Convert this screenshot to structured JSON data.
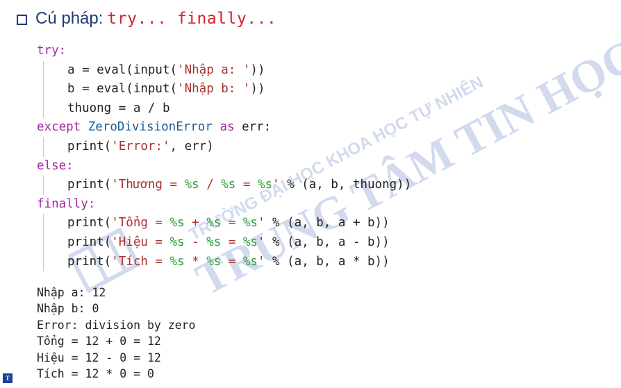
{
  "heading": {
    "label": "Cú pháp:",
    "code": "try... finally..."
  },
  "code": {
    "l1": "try:",
    "l2_pre": "a = eval(input(",
    "l2_str": "'Nhập a: '",
    "l2_post": "))",
    "l3_pre": "b = eval(input(",
    "l3_str": "'Nhập b: '",
    "l3_post": "))",
    "l4": "thuong = a / b",
    "l5_kw": "except",
    "l5_cls": "ZeroDivisionError",
    "l5_as": "as",
    "l5_var": "err:",
    "l6_pre": "print(",
    "l6_str": "'Error:'",
    "l6_post": ", err)",
    "l7": "else:",
    "l8_pre": "print(",
    "l8_q1": "'Thương = ",
    "l8_f1": "%s",
    "l8_m1": " / ",
    "l8_f2": "%s",
    "l8_m2": " = ",
    "l8_f3": "%s",
    "l8_q2": "'",
    "l8_post": " % (a, b, thuong))",
    "l9": "finally:",
    "l10_pre": "print(",
    "l10_q1": "'Tổng = ",
    "l10_f1": "%s",
    "l10_m1": " + ",
    "l10_f2": "%s",
    "l10_m2": " = ",
    "l10_f3": "%s",
    "l10_q2": "'",
    "l10_post": " % (a, b, a + b))",
    "l11_pre": "print(",
    "l11_q1": "'Hiệu = ",
    "l11_f1": "%s",
    "l11_m1": " - ",
    "l11_f2": "%s",
    "l11_m2": " = ",
    "l11_f3": "%s",
    "l11_q2": "'",
    "l11_post": " % (a, b, a - b))",
    "l12_pre": "print(",
    "l12_q1": "'Tích = ",
    "l12_f1": "%s",
    "l12_m1": " * ",
    "l12_f2": "%s",
    "l12_m2": " = ",
    "l12_f3": "%s",
    "l12_q2": "'",
    "l12_post": " % (a, b, a * b))"
  },
  "output": [
    "Nhập a: 12",
    "Nhập b: 0",
    "Error: division by zero",
    "Tổng = 12 + 0 = 12",
    "Hiệu = 12 - 0 = 12",
    "Tích = 12 * 0 = 0"
  ],
  "watermark": {
    "line1": "TRƯỜNG ĐẠI HỌC KHOA HỌC TỰ NHIÊN",
    "line2": "TRUNG TÂM TIN HỌC",
    "color": "#cdd5ea"
  },
  "logo": {
    "text": "T"
  }
}
